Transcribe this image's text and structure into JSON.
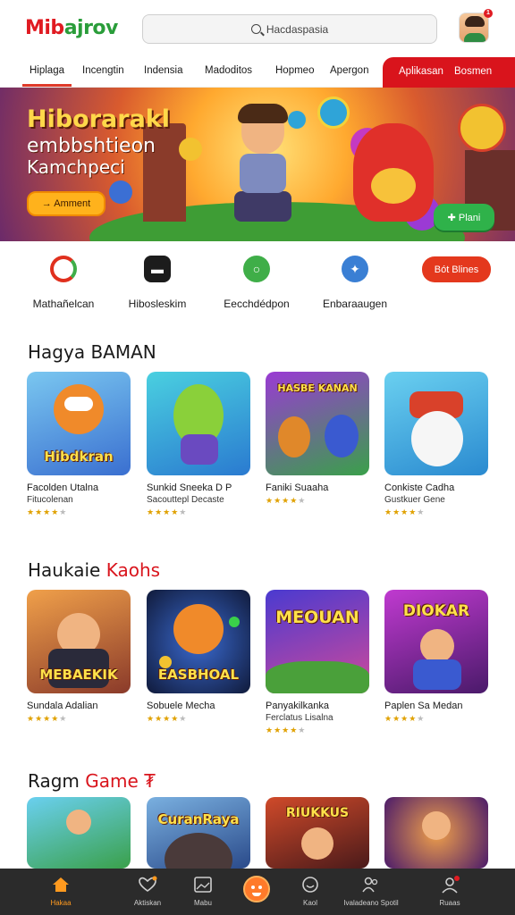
{
  "header": {
    "logo_part1": "Mib",
    "logo_part2": "ajrov",
    "search_placeholder": "Hacdaspasia",
    "notification_count": "1"
  },
  "nav": {
    "items": [
      "Hiplaga",
      "Incengtin",
      "Indensia",
      "Madoditos",
      "Hopmeo",
      "Apergon"
    ],
    "red_items": [
      "Aplikasan",
      "Bosmen"
    ]
  },
  "banner": {
    "title": "Hiborarakl",
    "subtitle_1": "embbshtieon",
    "subtitle_2": "Kamchpeci",
    "cta_label": "→ Amment",
    "play_label": "✚ Plani"
  },
  "quick": {
    "items": [
      {
        "label": "Mathañelcan",
        "color": "#e0301e"
      },
      {
        "label": "Hibosleskim",
        "color": "#1c1c1c"
      },
      {
        "label": "Eecchdédpon",
        "color": "#3fae48"
      },
      {
        "label": "Enbaraaugen",
        "color": "#3a7fd4"
      }
    ],
    "button_label": "Bót Blines"
  },
  "sections": {
    "s1": {
      "title": "Hagya BAMAN",
      "cards": [
        {
          "thumb": "Hibdkran",
          "title": "Facolden Utalna",
          "sub": "Fitucolenan",
          "rating": 4
        },
        {
          "thumb": "",
          "title": "Sunkid Sneeka D P",
          "sub": "Sacouttepl Decaste",
          "rating": 4
        },
        {
          "thumb": "HASBE KANAN",
          "title": "Faniki Suaaha",
          "sub": "",
          "rating": 4
        },
        {
          "thumb": "",
          "title": "Conkiste Cadha",
          "sub": "Gustkuer Gene",
          "rating": 4
        }
      ]
    },
    "s2": {
      "title_main": "Haukaie ",
      "title_red": "Kaohs",
      "cards": [
        {
          "thumb": "MEBAEKIK",
          "title": "Sundala Adalian",
          "sub": "",
          "rating": 4
        },
        {
          "thumb": "EASBHOAL",
          "title": "Sobuele Mecha",
          "sub": "",
          "rating": 4
        },
        {
          "thumb": "MEOUAN",
          "title": "Panyakilkanka",
          "sub": "Ferclatus Lisalna",
          "rating": 4
        },
        {
          "thumb": "DIOKAR",
          "title": "Paplen Sa Medan",
          "sub": "",
          "rating": 4
        }
      ]
    },
    "s3": {
      "title_main": "Ragm ",
      "title_red": "Game ₮",
      "cards": [
        {
          "thumb": ""
        },
        {
          "thumb": "CuranRaya"
        },
        {
          "thumb": "RIUKKUS"
        },
        {
          "thumb": ""
        }
      ]
    }
  },
  "bottom_nav": {
    "items": [
      "Hakaa",
      "Aktiskan",
      "Mabu",
      "",
      "Kaol",
      "Ivaladeano Spotil",
      "Ruaas"
    ]
  },
  "colors": {
    "accent_red": "#d9141c",
    "accent_orange": "#ff9a1f",
    "brand_green": "#2a9d3a"
  }
}
